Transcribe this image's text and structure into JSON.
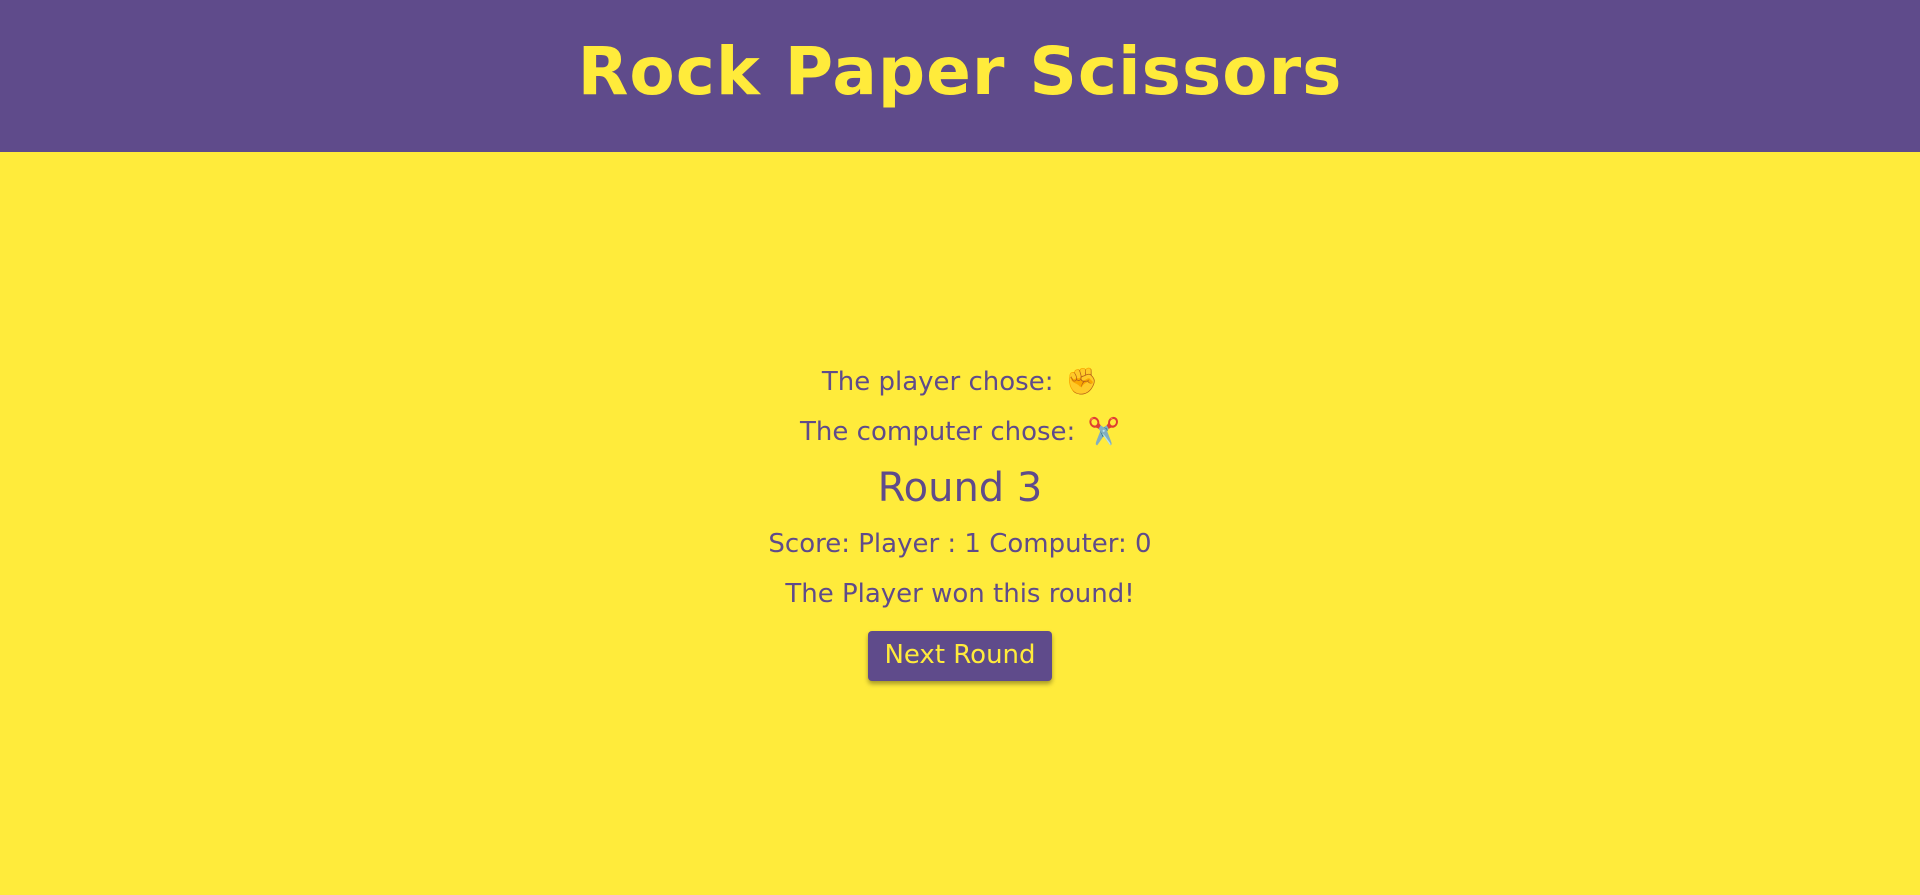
{
  "header": {
    "title": "Rock Paper Scissors"
  },
  "game": {
    "player_choice_label": "The player chose:",
    "player_choice_icon": "✊",
    "player_choice_icon_name": "raised-fist-icon",
    "computer_choice_label": "The computer chose:",
    "computer_choice_icon": "✂️",
    "computer_choice_icon_name": "scissors-icon",
    "round_label": "Round 3",
    "score_text": "Score: Player : 1 Computer: 0",
    "result_text": "The Player won this round!",
    "next_button_label": "Next Round"
  },
  "colors": {
    "primary_purple": "#5f4b8b",
    "background_yellow": "#ffeb3b"
  }
}
